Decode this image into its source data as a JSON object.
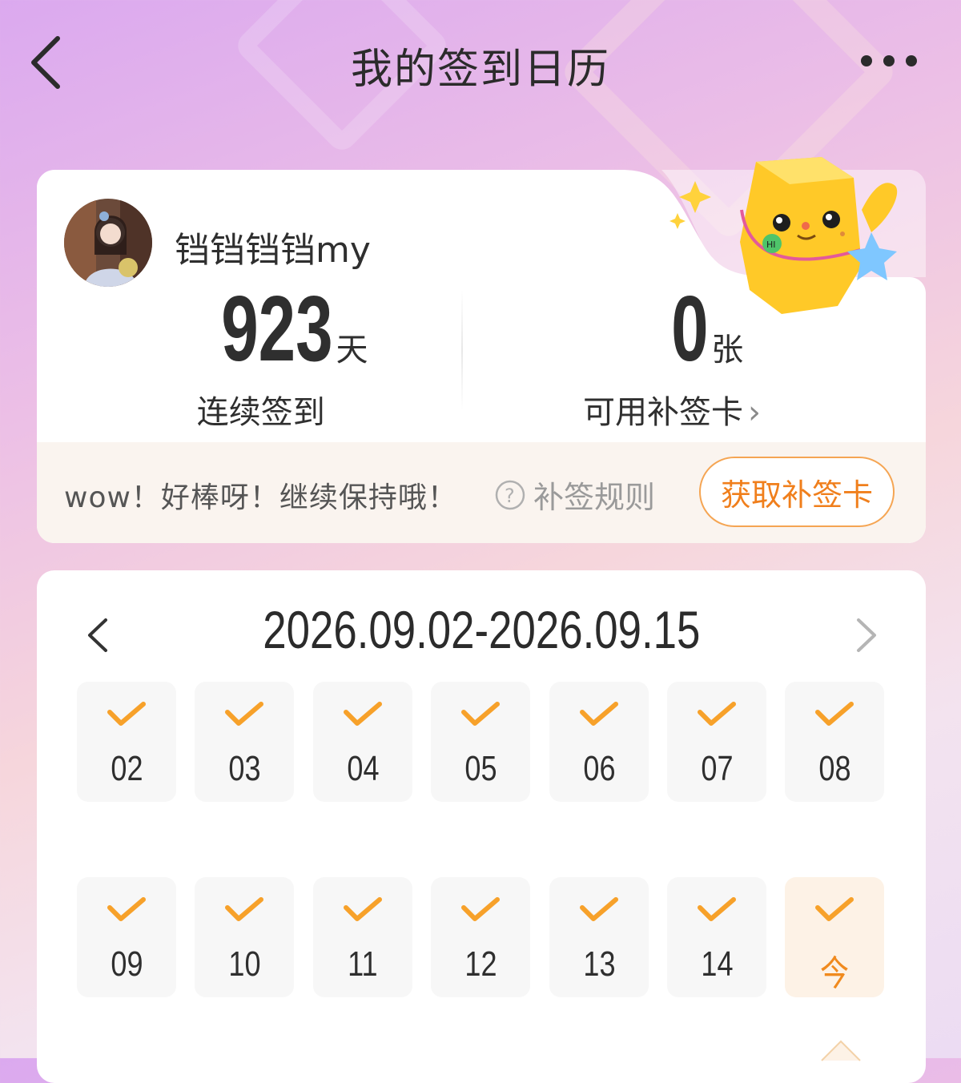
{
  "header": {
    "title": "我的签到日历",
    "back_icon": "chevron-left-icon",
    "more_icon": "more-dots-icon"
  },
  "user": {
    "name": "铛铛铛铛my"
  },
  "stats": {
    "streak": {
      "value": "923",
      "unit": "天",
      "label": "连续签到"
    },
    "cards": {
      "value": "0",
      "unit": "张",
      "label": "可用补签卡",
      "chevron": "›"
    }
  },
  "tip": {
    "text": "wow！好棒呀！继续保持哦！",
    "rules_label": "补签规则",
    "get_card_button": "获取补签卡"
  },
  "calendar": {
    "range": "2026.09.02-2026.09.15",
    "days": [
      {
        "label": "02",
        "checked": true
      },
      {
        "label": "03",
        "checked": true
      },
      {
        "label": "04",
        "checked": true
      },
      {
        "label": "05",
        "checked": true
      },
      {
        "label": "06",
        "checked": true
      },
      {
        "label": "07",
        "checked": true
      },
      {
        "label": "08",
        "checked": true
      },
      {
        "label": "09",
        "checked": true
      },
      {
        "label": "10",
        "checked": true
      },
      {
        "label": "11",
        "checked": true
      },
      {
        "label": "12",
        "checked": true
      },
      {
        "label": "13",
        "checked": true
      },
      {
        "label": "14",
        "checked": true
      },
      {
        "label": "今",
        "checked": true,
        "today": true
      }
    ]
  },
  "colors": {
    "accent": "#f08a1e",
    "check": "#f7a12a",
    "text": "#2f2f2f"
  }
}
